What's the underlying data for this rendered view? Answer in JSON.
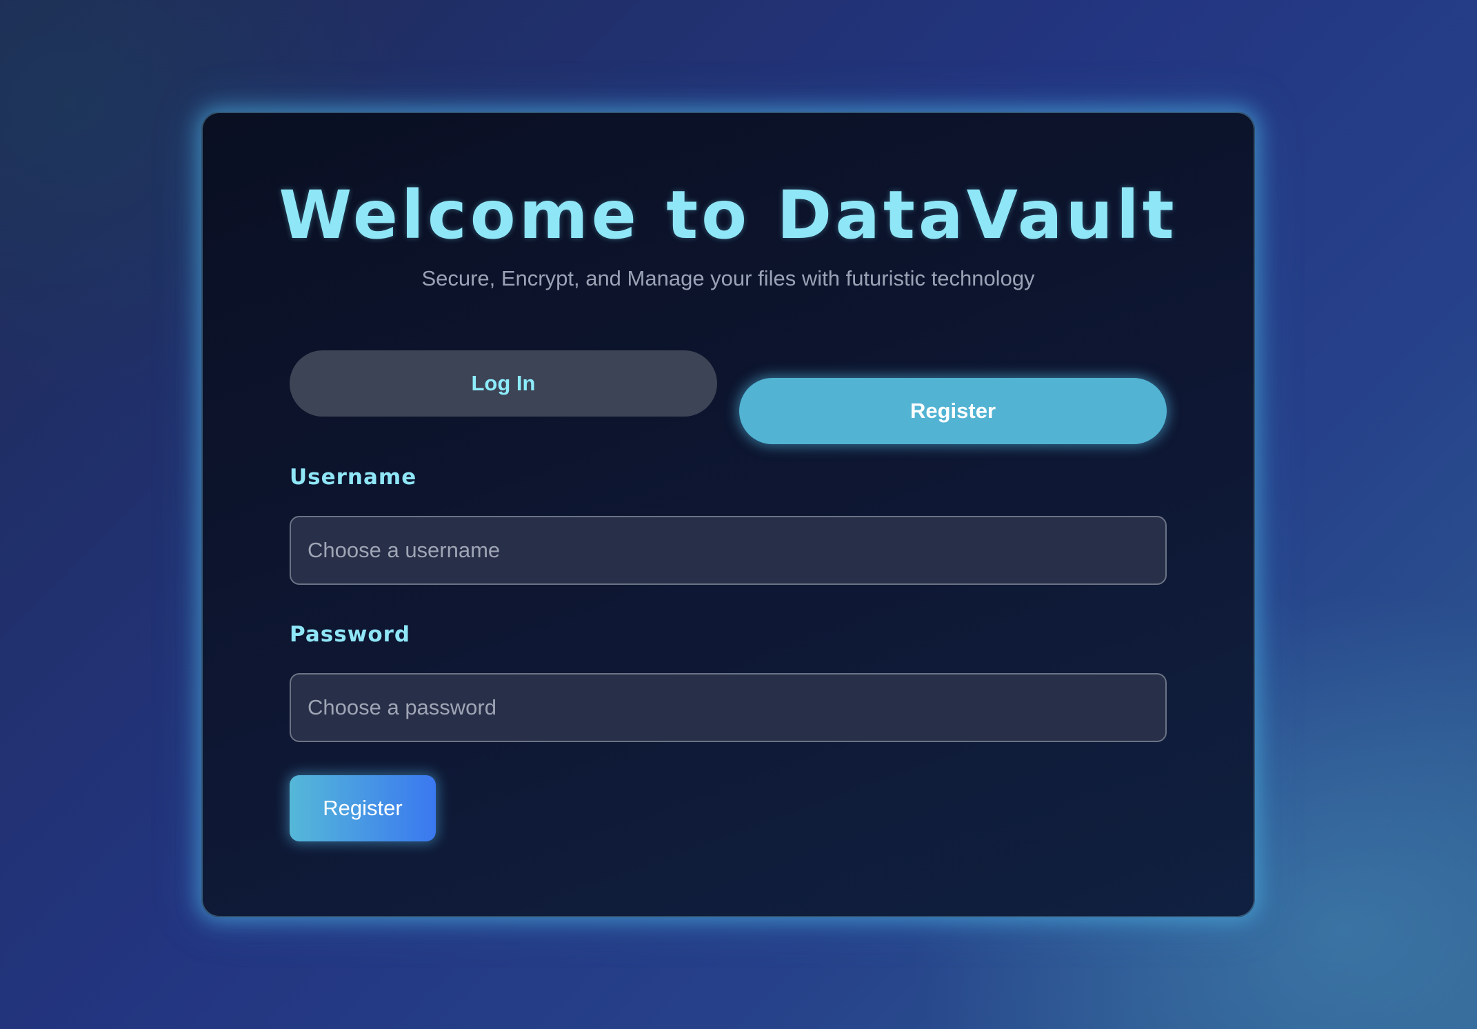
{
  "header": {
    "title": "Welcome to DataVault",
    "subtitle": "Secure, Encrypt, and Manage your files with futuristic technology"
  },
  "tabs": [
    {
      "label": "Log In",
      "active": false
    },
    {
      "label": "Register",
      "active": true
    }
  ],
  "form": {
    "username": {
      "label": "Username",
      "placeholder": "Choose a username",
      "value": ""
    },
    "password": {
      "label": "Password",
      "placeholder": "Choose a password",
      "value": ""
    },
    "submit_label": "Register"
  },
  "colors": {
    "accent": "#8fe6f6",
    "active_tab": "#52b3d3",
    "inactive_tab": "#3d4455",
    "submit_gradient_start": "#55b8d8",
    "submit_gradient_end": "#3a78f0"
  }
}
